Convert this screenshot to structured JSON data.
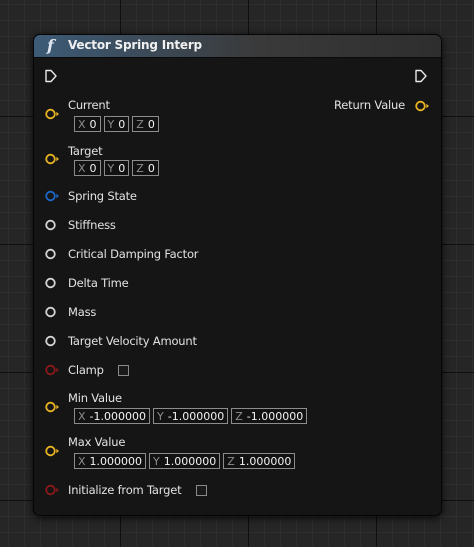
{
  "node": {
    "title": "Vector Spring Interp",
    "icon": "function-icon",
    "icon_glyph": "f"
  },
  "outputs": {
    "return_label": "Return Value"
  },
  "inputs": {
    "current": {
      "label": "Current",
      "x_axis": "X",
      "x": "0",
      "y_axis": "Y",
      "y": "0",
      "z_axis": "Z",
      "z": "0"
    },
    "target": {
      "label": "Target",
      "x_axis": "X",
      "x": "0",
      "y_axis": "Y",
      "y": "0",
      "z_axis": "Z",
      "z": "0"
    },
    "spring_state": {
      "label": "Spring State"
    },
    "stiffness": {
      "label": "Stiffness"
    },
    "critical_damping": {
      "label": "Critical Damping Factor"
    },
    "delta_time": {
      "label": "Delta Time"
    },
    "mass": {
      "label": "Mass"
    },
    "target_velocity": {
      "label": "Target Velocity Amount"
    },
    "clamp": {
      "label": "Clamp",
      "checked": false
    },
    "min_value": {
      "label": "Min Value",
      "x_axis": "X",
      "x": "-1.000000",
      "y_axis": "Y",
      "y": "-1.000000",
      "z_axis": "Z",
      "z": "-1.000000"
    },
    "max_value": {
      "label": "Max Value",
      "x_axis": "X",
      "x": "1.000000",
      "y_axis": "Y",
      "y": "1.000000",
      "z_axis": "Z",
      "z": "1.000000"
    },
    "init_from_target": {
      "label": "Initialize from Target",
      "checked": false
    }
  },
  "colors": {
    "vector_pin": "#e8b422",
    "struct_pin": "#1e68c8",
    "float_pin": "#d4d4d4",
    "bool_pin": "#8a1a1a",
    "exec_pin": "#e8e8e8",
    "header_accent": "#3d5b77"
  }
}
